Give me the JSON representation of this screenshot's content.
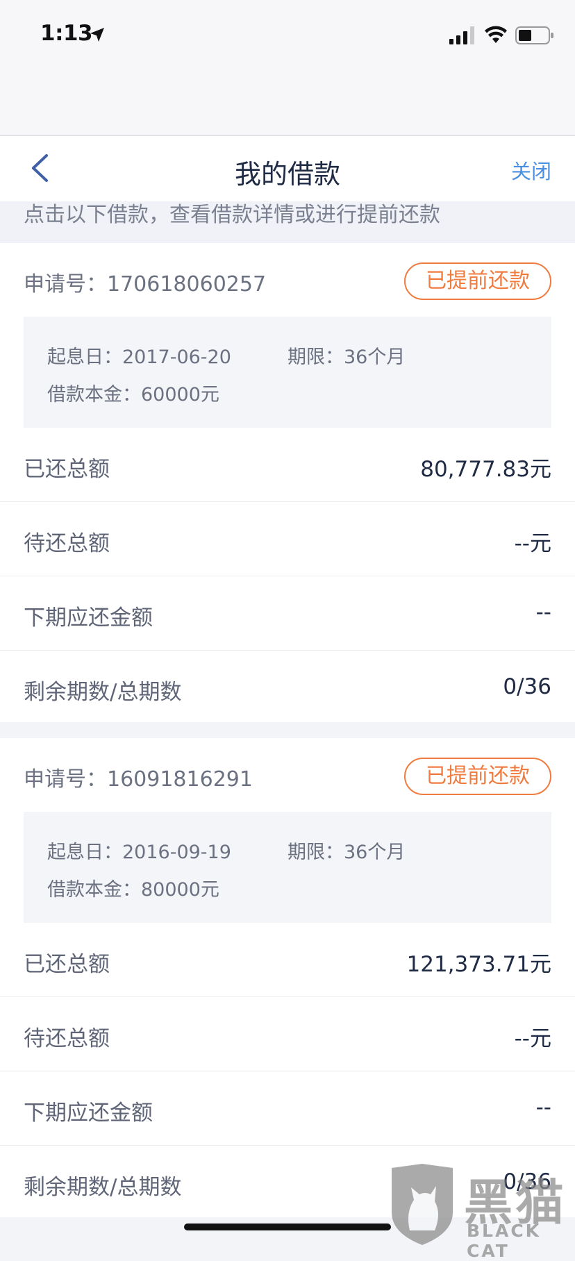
{
  "status_bar": {
    "time": "1:13",
    "location_icon": "location-arrow-icon",
    "signal_icon": "cellular-signal-icon",
    "wifi_icon": "wifi-icon",
    "battery_icon": "battery-icon"
  },
  "nav": {
    "back_icon": "chevron-left-icon",
    "title": "我的借款",
    "close_label": "关闭"
  },
  "hint": "点击以下借款，查看借款详情或进行提前还款",
  "loans": [
    {
      "app_number": "申请号：170618060257",
      "status": "已提前还款",
      "start_date": "起息日：2017-06-20",
      "term": "期限：36个月",
      "principal": "借款本金：60000元",
      "rows": [
        {
          "label": "已还总额",
          "value": "80,777.83元"
        },
        {
          "label": "待还总额",
          "value": "--元"
        },
        {
          "label": "下期应还金额",
          "value": "--"
        },
        {
          "label": "剩余期数/总期数",
          "value": "0/36"
        }
      ]
    },
    {
      "app_number": "申请号：16091816291",
      "status": "已提前还款",
      "start_date": "起息日：2016-09-19",
      "term": "期限：36个月",
      "principal": "借款本金：80000元",
      "rows": [
        {
          "label": "已还总额",
          "value": "121,373.71元"
        },
        {
          "label": "待还总额",
          "value": "--元"
        },
        {
          "label": "下期应还金额",
          "value": "--"
        },
        {
          "label": "剩余期数/总期数",
          "value": "0/36"
        }
      ]
    }
  ],
  "watermark": {
    "cn": "黑猫",
    "en": "BLACK CAT",
    "icon": "black-cat-logo-icon"
  },
  "colors": {
    "accent_blue": "#4a90e2",
    "badge_orange": "#f07b3f",
    "back_arrow": "#3f5fa6"
  }
}
